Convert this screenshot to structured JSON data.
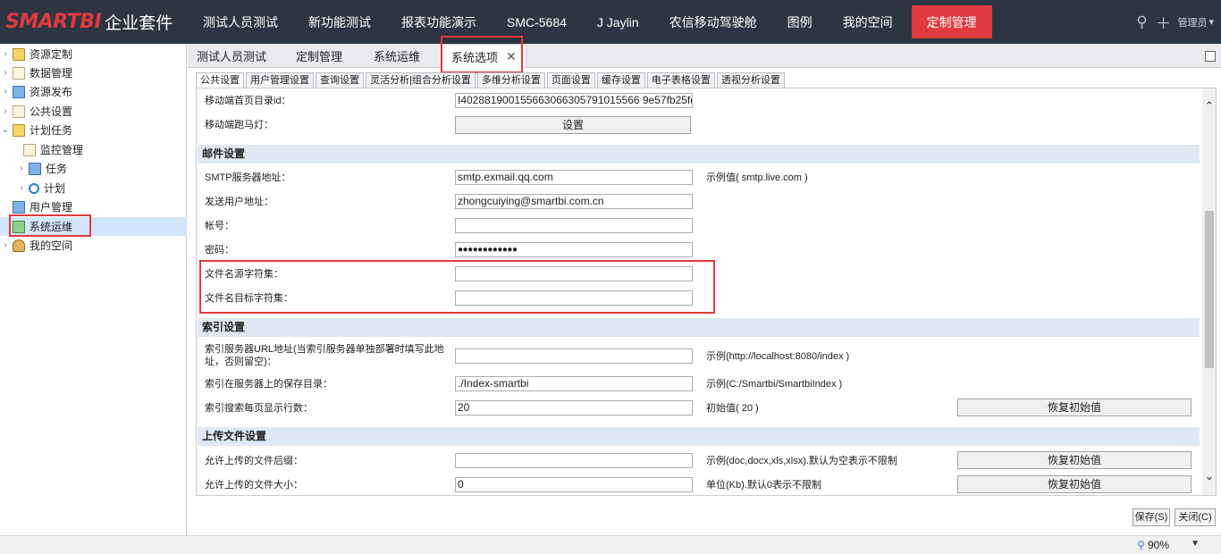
{
  "logo": {
    "brand": "SMARTBI",
    "suffix": "企业套件"
  },
  "topnav": [
    {
      "label": "测试人员测试"
    },
    {
      "label": "新功能测试"
    },
    {
      "label": "报表功能演示"
    },
    {
      "label": "SMC-5684"
    },
    {
      "label": "J Jaylin"
    },
    {
      "label": "农信移动驾驶舱"
    },
    {
      "label": "图例"
    },
    {
      "label": "我的空间"
    },
    {
      "label": "定制管理",
      "active": true
    }
  ],
  "top_right": {
    "user_label": "管理员",
    "search_icon": "search-icon",
    "add_icon": "plus-icon"
  },
  "tree": [
    {
      "label": "资源定制",
      "icon": "folder-icon"
    },
    {
      "label": "数据管理",
      "icon": "data-doc-icon"
    },
    {
      "label": "资源发布",
      "icon": "publish-icon"
    },
    {
      "label": "公共设置",
      "icon": "settings-doc-icon"
    },
    {
      "label": "计划任务",
      "icon": "schedule-icon"
    },
    {
      "label": "监控管理",
      "icon": "monitor-icon"
    },
    {
      "label": "任务",
      "icon": "task-icon"
    },
    {
      "label": "计划",
      "icon": "clock-icon"
    },
    {
      "label": "用户管理",
      "icon": "user-manage-icon"
    },
    {
      "label": "系统运维",
      "icon": "system-ops-icon",
      "selected": true
    },
    {
      "label": "我的空间",
      "icon": "person-icon"
    }
  ],
  "tabs": [
    {
      "label": "测试人员测试"
    },
    {
      "label": "定制管理"
    },
    {
      "label": "系统运维"
    },
    {
      "label": "系统选项",
      "active": true
    }
  ],
  "subtabs": [
    {
      "label": "公共设置",
      "active": true
    },
    {
      "label": "用户管理设置"
    },
    {
      "label": "查询设置"
    },
    {
      "label": "灵活分析|组合分析设置"
    },
    {
      "label": "多维分析设置"
    },
    {
      "label": "页面设置"
    },
    {
      "label": "缓存设置"
    },
    {
      "label": "电子表格设置"
    },
    {
      "label": "透视分析设置"
    }
  ],
  "form": {
    "mobile_home_label": "移动端首页目录id：",
    "mobile_home_value": "I402881900155663066305791015566 9e57fb25fd",
    "mobile_marquee_label": "移动端跑马灯：",
    "mobile_marquee_button": "设置",
    "mail_section": "邮件设置",
    "smtp_label": "SMTP服务器地址：",
    "smtp_value": "smtp.exmail.qq.com",
    "smtp_hint": "示例值( smtp.live.com )",
    "sender_label": "发送用户地址：",
    "sender_value": "zhongcuiying@smartbi.com.cn",
    "account_label": "帐号：",
    "account_value": "",
    "password_label": "密码：",
    "password_value": "●●●●●●●●●●●●",
    "filename_src_label": "文件名源字符集：",
    "filename_src_value": "",
    "filename_dst_label": "文件名目标字符集：",
    "filename_dst_value": "",
    "index_section": "索引设置",
    "index_url_label": "索引服务器URL地址(当索引服务器单独部署时填写此地址，否则留空)：",
    "index_url_value": "",
    "index_url_hint": "示例(http://localhost:8080/index )",
    "index_dir_label": "索引在服务器上的保存目录：",
    "index_dir_value": "./Index-smartbi",
    "index_dir_hint": "示例(C:/Smartbi/SmartbiIndex )",
    "index_rows_label": "索引搜索每页显示行数：",
    "index_rows_value": "20",
    "index_rows_hint": "初始值( 20 )",
    "reset_label": "恢复初始值",
    "upload_section": "上传文件设置",
    "upload_ext_label": "允许上传的文件后缀：",
    "upload_ext_value": "",
    "upload_ext_hint": "示例(doc,docx,xls,xlsx).默认为空表示不限制",
    "upload_size_label": "允许上传的文件大小：",
    "upload_size_value": "0",
    "upload_size_hint": "单位(Kb).默认0表示不限制"
  },
  "bottom": {
    "save_label": "保存(S)",
    "close_label": "关闭(C)"
  },
  "status": {
    "zoom": "90%"
  },
  "colors": {
    "topbar": "#2c3541",
    "accent": "#e03a3e",
    "section": "#dfe8f3",
    "selected": "#d3e5fa"
  }
}
